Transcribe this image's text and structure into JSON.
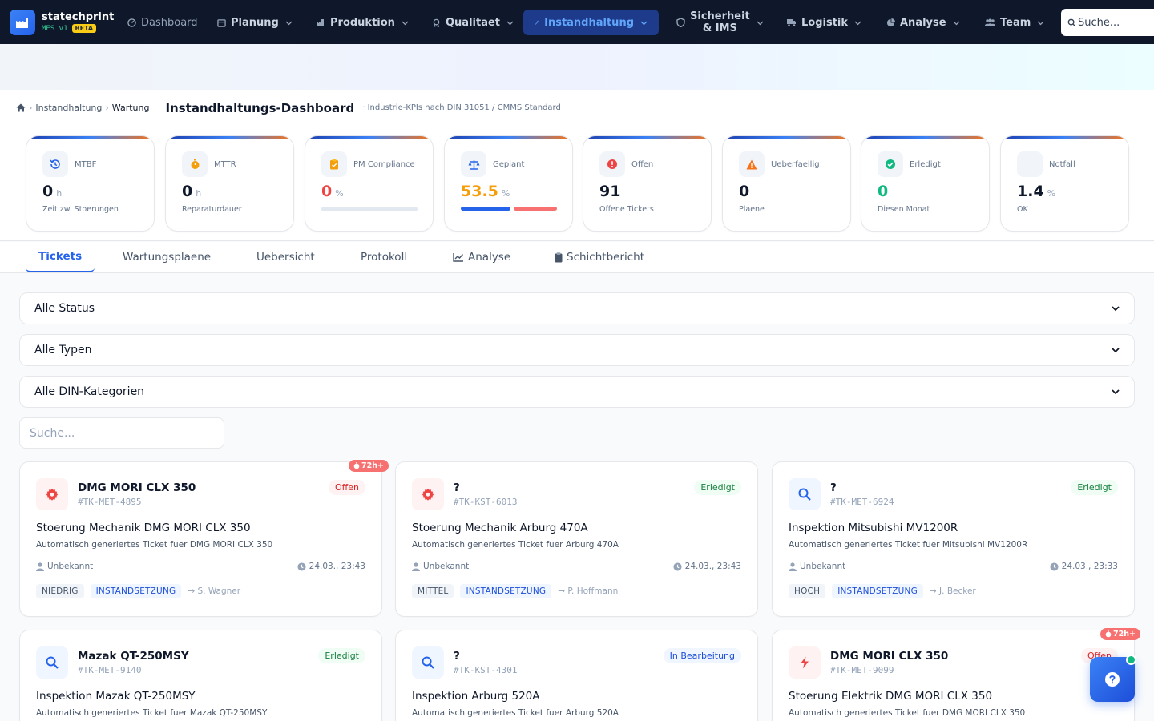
{
  "brand": {
    "name": "statechprint",
    "sub": "MES v1",
    "beta": "BETA"
  },
  "nav": {
    "dashboard": "Dashboard",
    "planung": "Planung",
    "produktion": "Produktion",
    "qualitaet": "Qualitaet",
    "instandhaltung": "Instandhaltung",
    "sicherheit_1": "Sicherheit",
    "sicherheit_2": "& IMS",
    "logistik": "Logistik",
    "analyse": "Analyse",
    "team": "Team",
    "search_placeholder": "Suche..."
  },
  "breadcrumb": {
    "item1": "Instandhaltung",
    "item2": "Wartung"
  },
  "header": {
    "title": "Instandhaltungs-Dashboard",
    "subtitle": "· Industrie-KPIs nach DIN 31051 / CMMS Standard"
  },
  "kpis": [
    {
      "label": "MTBF",
      "value": "0",
      "unit": "h",
      "sub": "Zeit zw. Stoerungen",
      "icon": "history-icon"
    },
    {
      "label": "MTTR",
      "value": "0",
      "unit": "h",
      "sub": "Reparaturdauer",
      "icon": "stopwatch-icon"
    },
    {
      "label": "PM Compliance",
      "value": "0",
      "unit": "%",
      "sub": "",
      "icon": "clipboard-check-icon",
      "progress": 0
    },
    {
      "label": "Geplant",
      "value": "53.5",
      "unit": "%",
      "sub": "",
      "icon": "balance-scale-icon",
      "planned_pct": 53.5
    },
    {
      "label": "Offen",
      "value": "91",
      "unit": "",
      "sub": "Offene Tickets",
      "icon": "alert-circle-icon"
    },
    {
      "label": "Ueberfaellig",
      "value": "0",
      "unit": "",
      "sub": "Plaene",
      "icon": "warning-triangle-icon"
    },
    {
      "label": "Erledigt",
      "value": "0",
      "unit": "",
      "sub": "Diesen Monat",
      "icon": "check-circle-icon"
    },
    {
      "label": "Notfall",
      "value": "1.4",
      "unit": "%",
      "sub": "OK",
      "icon": ""
    }
  ],
  "kpi_colors": {
    "pm_value": "#ef4444",
    "geplant_value": "#f59e0b",
    "erledigt_value": "#10b981"
  },
  "tabs": {
    "tickets": "Tickets",
    "wartungsplaene": "Wartungsplaene",
    "uebersicht": "Uebersicht",
    "protokoll": "Protokoll",
    "analyse": "Analyse",
    "schichtbericht": "Schichtbericht"
  },
  "filters": {
    "status": "Alle Status",
    "typen": "Alle Typen",
    "din": "Alle DIN-Kategorien",
    "search_placeholder": "Suche..."
  },
  "tickets": [
    {
      "machine": "DMG MORI CLX 350",
      "id": "#TK-MET-4895",
      "status": "Offen",
      "title": "Stoerung Mechanik DMG MORI CLX 350",
      "desc": "Automatisch generiertes Ticket fuer DMG MORI CLX 350",
      "user": "Unbekannt",
      "time": "24.03., 23:43",
      "prio": "NIEDRIG",
      "type": "INSTANDSETZUNG",
      "assignee": "→ S. Wagner",
      "overdue": "72h+",
      "icon": "gear-icon"
    },
    {
      "machine": "?",
      "id": "#TK-KST-6013",
      "status": "Erledigt",
      "title": "Stoerung Mechanik Arburg 470A",
      "desc": "Automatisch generiertes Ticket fuer Arburg 470A",
      "user": "Unbekannt",
      "time": "24.03., 23:43",
      "prio": "MITTEL",
      "type": "INSTANDSETZUNG",
      "assignee": "→ P. Hoffmann",
      "overdue": "",
      "icon": "gear-icon"
    },
    {
      "machine": "?",
      "id": "#TK-MET-6924",
      "status": "Erledigt",
      "title": "Inspektion Mitsubishi MV1200R",
      "desc": "Automatisch generiertes Ticket fuer Mitsubishi MV1200R",
      "user": "Unbekannt",
      "time": "24.03., 23:33",
      "prio": "HOCH",
      "type": "INSTANDSETZUNG",
      "assignee": "→ J. Becker",
      "overdue": "",
      "icon": "search-icon"
    },
    {
      "machine": "Mazak QT-250MSY",
      "id": "#TK-MET-9140",
      "status": "Erledigt",
      "title": "Inspektion Mazak QT-250MSY",
      "desc": "Automatisch generiertes Ticket fuer Mazak QT-250MSY",
      "icon": "search-icon"
    },
    {
      "machine": "?",
      "id": "#TK-KST-4301",
      "status": "In Bearbeitung",
      "title": "Inspektion Arburg 520A",
      "desc": "Automatisch generiertes Ticket fuer Arburg 520A",
      "icon": "search-icon"
    },
    {
      "machine": "DMG MORI CLX 350",
      "id": "#TK-MET-9099",
      "status": "Offen",
      "title": "Stoerung Elektrik DMG MORI CLX 350",
      "desc": "Automatisch generiertes Ticket fuer DMG MORI CLX 350",
      "overdue": "72h+",
      "icon": "lightning-icon"
    }
  ]
}
